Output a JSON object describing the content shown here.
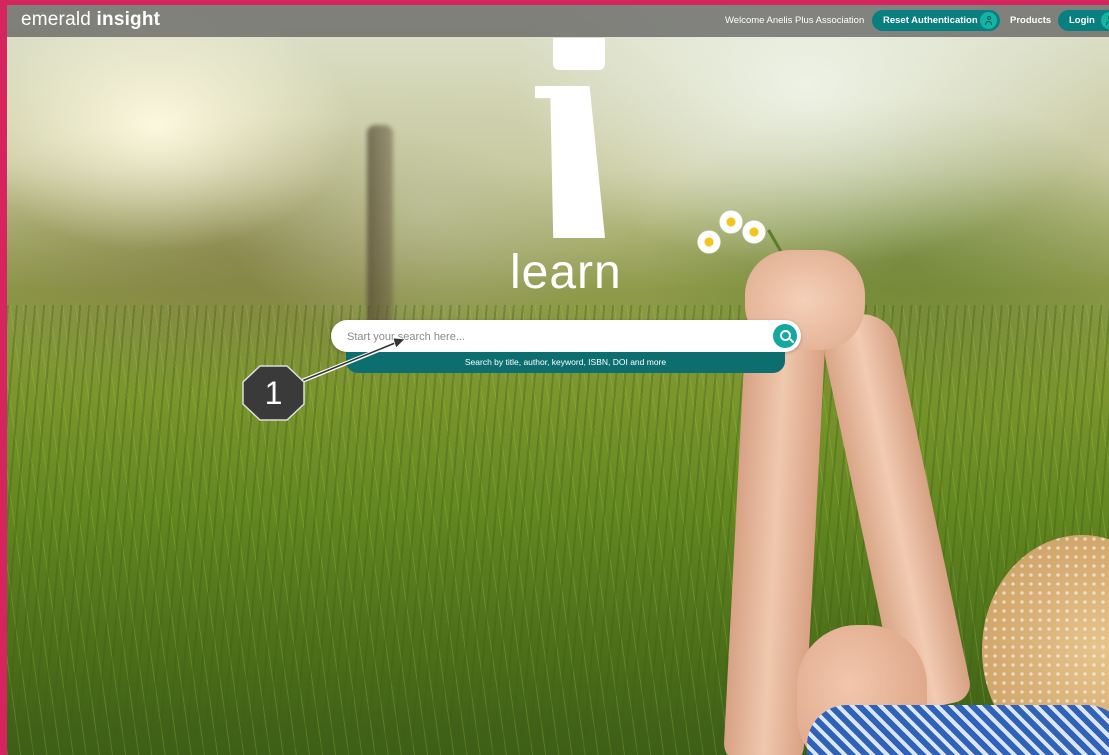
{
  "header": {
    "logo_light": "emerald",
    "logo_bold": "insight",
    "welcome_text": "Welcome Anelis Plus Association",
    "reset_button_label": "Reset Authentication",
    "products_label": "Products",
    "login_button_label": "Login"
  },
  "hero": {
    "word": "learn"
  },
  "search": {
    "placeholder": "Start your search here...",
    "hint": "Search by title, author, keyword, ISBN, DOI and more"
  },
  "annotation": {
    "step_number": "1"
  },
  "colors": {
    "frame": "#d6245e",
    "teal_button": "#0a7f7f",
    "teal_icon": "#14b3a6",
    "hint_bar": "#0d6e70",
    "badge": "#3a3a3a"
  }
}
